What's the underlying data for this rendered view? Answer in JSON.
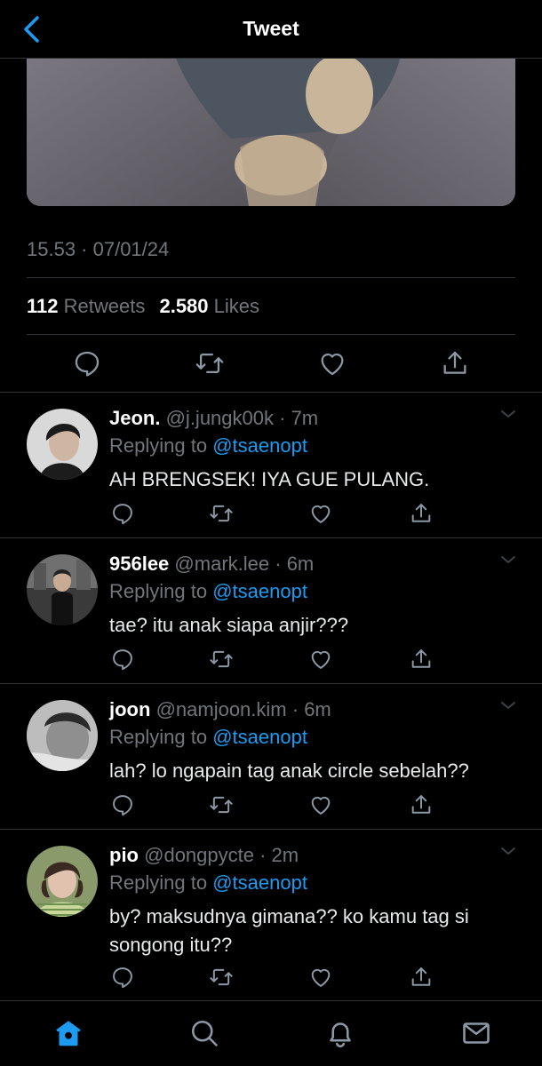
{
  "header": {
    "title": "Tweet",
    "back_icon": "chevron-left-icon"
  },
  "tweet": {
    "timestamp": "15.53 · 07/01/24",
    "stats": {
      "retweets_count": "112",
      "retweets_label": "Retweets",
      "likes_count": "2.580",
      "likes_label": "Likes"
    }
  },
  "replies": [
    {
      "name": "Jeon.",
      "handle": "@j.jungk00k",
      "time": "· 7m",
      "replying_label": "Replying to",
      "mention": "@tsaenopt",
      "text": "AH BRENGSEK! IYA GUE PULANG."
    },
    {
      "name": "956lee",
      "handle": "@mark.lee",
      "time": "· 6m",
      "replying_label": "Replying to",
      "mention": "@tsaenopt",
      "text": "tae? itu anak siapa anjir???"
    },
    {
      "name": "joon",
      "handle": "@namjoon.kim",
      "time": "· 6m",
      "replying_label": "Replying to",
      "mention": "@tsaenopt",
      "text": "lah? lo ngapain tag anak circle sebelah??"
    },
    {
      "name": "pio",
      "handle": "@dongpycte",
      "time": "· 2m",
      "replying_label": "Replying to",
      "mention": "@tsaenopt",
      "text": "by? maksudnya gimana?? ko kamu tag si songong itu??"
    }
  ],
  "colors": {
    "accent": "#1d9bf0",
    "muted": "#71767b",
    "divider": "#2f3336",
    "background": "#000000"
  },
  "tabbar": {
    "icons": [
      "home-icon",
      "search-icon",
      "notifications-icon",
      "messages-icon"
    ]
  }
}
